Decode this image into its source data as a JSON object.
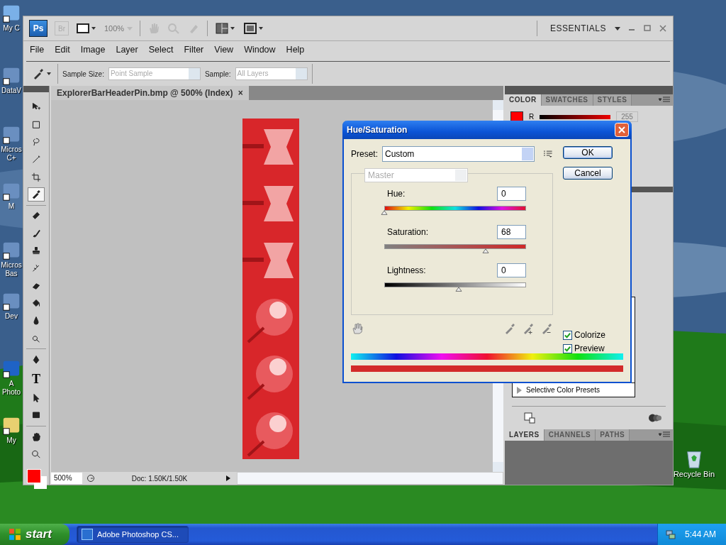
{
  "desktop": {
    "icons": [
      {
        "label": "My C",
        "kind": "computer"
      },
      {
        "label": "DataV",
        "kind": "shortcut"
      },
      {
        "label": "Micros C+",
        "kind": "shortcut"
      },
      {
        "label": "M",
        "kind": "shortcut"
      },
      {
        "label": "Micros Bas",
        "kind": "shortcut"
      },
      {
        "label": "Dev",
        "kind": "shortcut"
      },
      {
        "label": "A Photo",
        "kind": "app"
      },
      {
        "label": "My",
        "kind": "folder"
      }
    ],
    "recycle_bin": {
      "label": "Recycle Bin"
    }
  },
  "app": {
    "logo": "Ps",
    "bridge": "Br",
    "zoom": "100%",
    "workspace": "ESSENTIALS",
    "menu": [
      "File",
      "Edit",
      "Image",
      "Layer",
      "Select",
      "Filter",
      "View",
      "Window",
      "Help"
    ],
    "options": {
      "sample_size_label": "Sample Size:",
      "sample_size": "Point Sample",
      "sample_label": "Sample:",
      "sample": "All Layers"
    },
    "tools": [
      {
        "kind": "move",
        "selected": false
      },
      {
        "kind": "marquee",
        "selected": false
      },
      {
        "kind": "lasso",
        "selected": false
      },
      {
        "kind": "wand",
        "selected": false
      },
      {
        "kind": "crop",
        "selected": false
      },
      {
        "kind": "eyedropper",
        "selected": true
      },
      {
        "kind": "heal",
        "selected": false
      },
      {
        "kind": "brush",
        "selected": false
      },
      {
        "kind": "stamp",
        "selected": false
      },
      {
        "kind": "history",
        "selected": false
      },
      {
        "kind": "eraser",
        "selected": false
      },
      {
        "kind": "bucket",
        "selected": false
      },
      {
        "kind": "blur",
        "selected": false
      },
      {
        "kind": "dodge",
        "selected": false
      },
      {
        "kind": "pen",
        "selected": false
      },
      {
        "kind": "type",
        "glyph": "T",
        "selected": false
      },
      {
        "kind": "select",
        "selected": false
      },
      {
        "kind": "shape",
        "selected": false
      },
      {
        "kind": "hand",
        "selected": false
      },
      {
        "kind": "zoom",
        "selected": false
      }
    ]
  },
  "document": {
    "tab": "ExplorerBarHeaderPin.bmp @ 500% (Index)",
    "close": "×",
    "zoom": "500%",
    "info": "Doc: 1.50K/1.50K"
  },
  "panels": {
    "color_tabs": [
      {
        "label": "COLOR",
        "selected": true
      },
      {
        "label": "SWATCHES",
        "selected": false
      },
      {
        "label": "STYLES",
        "selected": false
      }
    ],
    "channel": {
      "label": "R",
      "value": "255",
      "level": 1
    },
    "presets": [
      "Selective Color Presets"
    ],
    "layer_tabs": [
      {
        "label": "LAYERS",
        "selected": true
      },
      {
        "label": "CHANNELS",
        "selected": false
      },
      {
        "label": "PATHS",
        "selected": false
      }
    ]
  },
  "dialog": {
    "title": "Hue/Saturation",
    "preset_label": "Preset:",
    "preset": "Custom",
    "channel": "Master",
    "sliders": [
      {
        "kind": "hue",
        "label": "Hue:",
        "value": "0",
        "level": 0
      },
      {
        "kind": "saturation",
        "label": "Saturation:",
        "value": "68",
        "level": 0.68
      },
      {
        "kind": "lightness",
        "label": "Lightness:",
        "value": "0",
        "level": 0.5
      }
    ],
    "buttons": [
      "OK",
      "Cancel"
    ],
    "checkboxes": [
      {
        "label": "Colorize",
        "checked": true
      },
      {
        "label": "Preview",
        "checked": true
      }
    ]
  },
  "taskbar": {
    "start": "start",
    "tasks": [
      {
        "label": "Adobe Photoshop CS...",
        "selected": true
      }
    ],
    "clock": "5:44 AM"
  }
}
